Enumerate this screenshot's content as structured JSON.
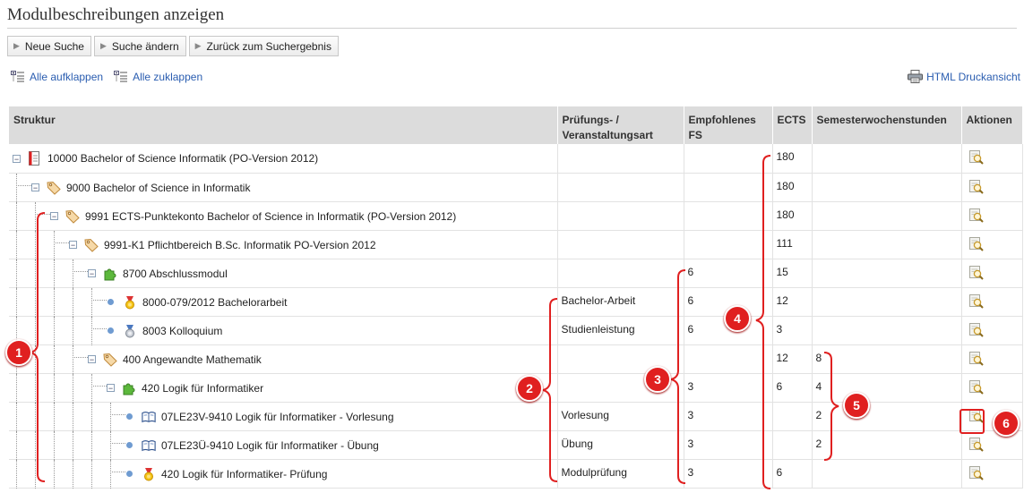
{
  "page": {
    "title": "Modulbeschreibungen anzeigen"
  },
  "toolbar": {
    "new_search": "Neue Suche",
    "change_search": "Suche ändern",
    "back_to_results": "Zurück zum Suchergebnis"
  },
  "links": {
    "expand_all": "Alle aufklappen",
    "collapse_all": "Alle zuklappen",
    "print_view": "HTML Druckansicht"
  },
  "table": {
    "headers": {
      "structure": "Struktur",
      "exam_type_line1": "Prüfungs- /",
      "exam_type_line2": "Veranstaltungsart",
      "semester_line1": "Empfohlenes",
      "semester_line2": "FS",
      "ects": "ECTS",
      "sws": "Semesterwochenstunden",
      "actions": "Aktionen"
    },
    "rows": [
      {
        "label": "10000 Bachelor of Science Informatik (PO-Version 2012)",
        "icon": "document-icon",
        "art": "",
        "fs": "",
        "ects": "180",
        "sws": ""
      },
      {
        "label": "9000 Bachelor of Science in Informatik",
        "icon": "tag-icon",
        "art": "",
        "fs": "",
        "ects": "180",
        "sws": ""
      },
      {
        "label": "9991 ECTS-Punktekonto Bachelor of Science in Informatik (PO-Version 2012)",
        "icon": "tag-icon",
        "art": "",
        "fs": "",
        "ects": "180",
        "sws": ""
      },
      {
        "label": "9991-K1 Pflichtbereich B.Sc. Informatik PO-Version 2012",
        "icon": "tag-icon",
        "art": "",
        "fs": "",
        "ects": "111",
        "sws": ""
      },
      {
        "label": "8700 Abschlussmodul",
        "icon": "puzzle-icon",
        "art": "",
        "fs": "6",
        "ects": "15",
        "sws": ""
      },
      {
        "label": "8000-079/2012 Bachelorarbeit",
        "icon": "medal-gold-icon",
        "art": "Bachelor-Arbeit",
        "fs": "6",
        "ects": "12",
        "sws": ""
      },
      {
        "label": "8003 Kolloquium",
        "icon": "medal-silver-icon",
        "art": "Studienleistung",
        "fs": "6",
        "ects": "3",
        "sws": ""
      },
      {
        "label": "400 Angewandte Mathematik",
        "icon": "tag-icon",
        "art": "",
        "fs": "",
        "ects": "12",
        "sws": "8"
      },
      {
        "label": "420 Logik für Informatiker",
        "icon": "puzzle-icon",
        "art": "",
        "fs": "3",
        "ects": "6",
        "sws": "4"
      },
      {
        "label": "07LE23V-9410 Logik für Informatiker - Vorlesung",
        "icon": "book-icon",
        "art": "Vorlesung",
        "fs": "3",
        "ects": "",
        "sws": "2"
      },
      {
        "label": "07LE23Ü-9410 Logik für Informatiker - Übung",
        "icon": "book-icon",
        "art": "Übung",
        "fs": "3",
        "ects": "",
        "sws": "2"
      },
      {
        "label": "420 Logik für Informatiker- Prüfung",
        "icon": "medal-gold-icon",
        "art": "Modulprüfung",
        "fs": "3",
        "ects": "6",
        "sws": ""
      }
    ]
  },
  "annotations": [
    "1",
    "2",
    "3",
    "4",
    "5",
    "6"
  ],
  "colors": {
    "link": "#2a5db0",
    "header_bg": "#dcdcdc",
    "annotation_red": "#e02020"
  }
}
